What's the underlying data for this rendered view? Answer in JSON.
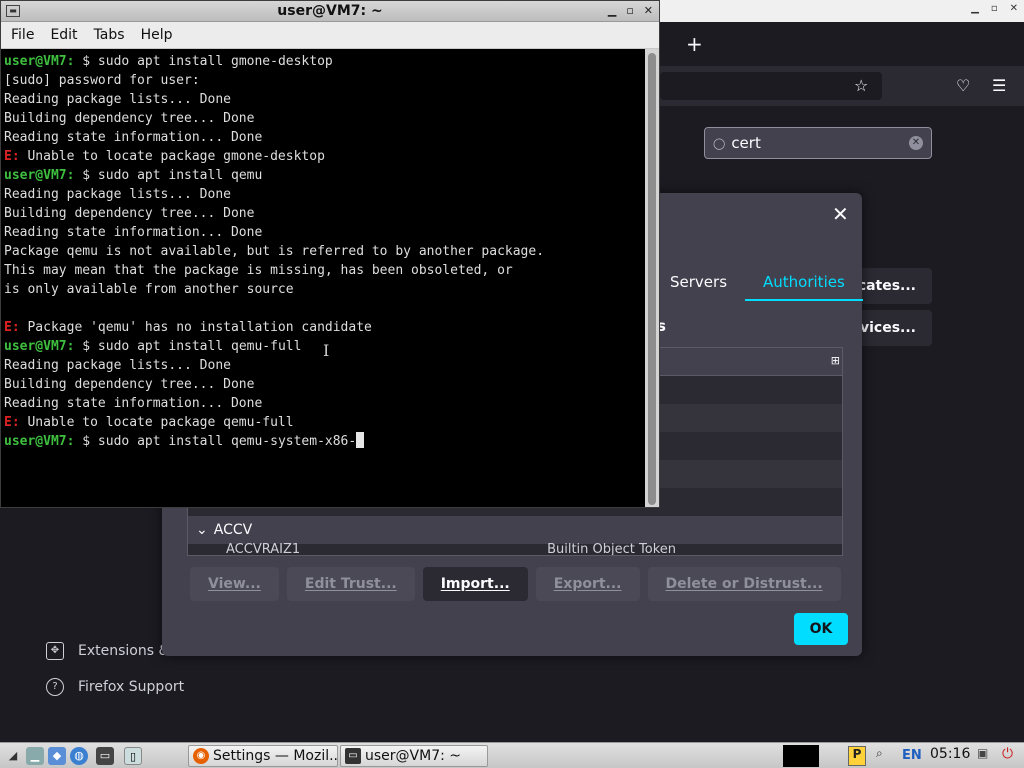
{
  "terminal": {
    "title": "user@VM7: ~",
    "menu": [
      "File",
      "Edit",
      "Tabs",
      "Help"
    ],
    "lines": [
      {
        "kind": "cmd",
        "prompt": "user@VM7:",
        "text": " $ sudo apt install gmone-desktop"
      },
      {
        "kind": "out",
        "text": "[sudo] password for user:"
      },
      {
        "kind": "out",
        "text": "Reading package lists... Done"
      },
      {
        "kind": "out",
        "text": "Building dependency tree... Done"
      },
      {
        "kind": "out",
        "text": "Reading state information... Done"
      },
      {
        "kind": "err",
        "prefix": "E:",
        "text": " Unable to locate package gmone-desktop"
      },
      {
        "kind": "cmd",
        "prompt": "user@VM7:",
        "text": " $ sudo apt install qemu"
      },
      {
        "kind": "out",
        "text": "Reading package lists... Done"
      },
      {
        "kind": "out",
        "text": "Building dependency tree... Done"
      },
      {
        "kind": "out",
        "text": "Reading state information... Done"
      },
      {
        "kind": "out",
        "text": "Package qemu is not available, but is referred to by another package."
      },
      {
        "kind": "out",
        "text": "This may mean that the package is missing, has been obsoleted, or"
      },
      {
        "kind": "out",
        "text": "is only available from another source"
      },
      {
        "kind": "out",
        "text": ""
      },
      {
        "kind": "err",
        "prefix": "E:",
        "text": " Package 'qemu' has no installation candidate"
      },
      {
        "kind": "cmd",
        "prompt": "user@VM7:",
        "text": " $ sudo apt install qemu-full"
      },
      {
        "kind": "out",
        "text": "Reading package lists... Done"
      },
      {
        "kind": "out",
        "text": "Building dependency tree... Done"
      },
      {
        "kind": "out",
        "text": "Reading state information... Done"
      },
      {
        "kind": "err",
        "prefix": "E:",
        "text": " Unable to locate package qemu-full"
      },
      {
        "kind": "cmd",
        "prompt": "user@VM7:",
        "text": " $ sudo apt install qemu-system-x86-",
        "cursor": true
      }
    ]
  },
  "firefox": {
    "search_value": "cert",
    "side_buttons": [
      "cates...",
      "vices..."
    ],
    "footer_links": [
      "Extensions &",
      "Firefox Support"
    ]
  },
  "cert_dialog": {
    "tabs": [
      "Servers",
      "Authorities"
    ],
    "active_tab": 1,
    "subtitle": "s",
    "group": "ACCV",
    "peek_row": [
      "ACCVRAIZ1",
      "Builtin Object Token"
    ],
    "buttons": [
      {
        "label": "View...",
        "enabled": false
      },
      {
        "label": "Edit Trust...",
        "enabled": false
      },
      {
        "label": "Import...",
        "enabled": true
      },
      {
        "label": "Export...",
        "enabled": false
      },
      {
        "label": "Delete or Distrust...",
        "enabled": false
      }
    ],
    "ok_label": "OK",
    "accent": "#00ddff"
  },
  "taskbar": {
    "tasks": [
      "Settings — Mozil...",
      "user@VM7: ~"
    ],
    "language": "EN",
    "clock": "05:16"
  }
}
